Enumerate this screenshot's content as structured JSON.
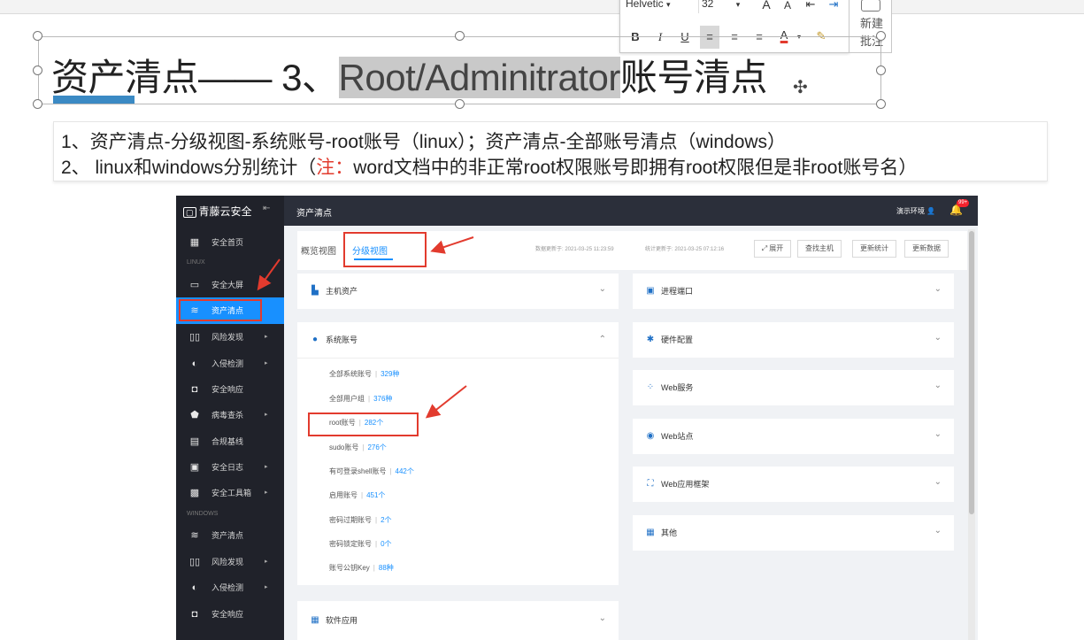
{
  "toolbar": {
    "font_name": "Helvetic",
    "font_size": "32",
    "font_dropdown": "▾",
    "size_dropdown": "▾",
    "grow_font": "A",
    "shrink_font": "A",
    "bold": "B",
    "italic": "I",
    "underline": "U",
    "font_color": "A",
    "new_comment": "新建批注"
  },
  "slide": {
    "title_prefix": "资产清点—— 3、",
    "title_selected": "Root/Adminitrator",
    "title_suffix": "账号清点",
    "desc_line1": "1、资产清点-分级视图-系统账号-root账号（linux）；资产清点-全部账号清点（windows）",
    "desc_line2_a": "2、 linux和windows分别统计（",
    "desc_line2_note": "注：",
    "desc_line2_b": "word文档中的非正常root权限账号即拥有root权限但是非root账号名）"
  },
  "app": {
    "logo": "青藤云安全",
    "fold_icon": "⇤",
    "topbar_title": "资产清点",
    "env_label": "演示环境",
    "badge": "99+",
    "sidebar": {
      "group_linux": "LINUX",
      "group_windows": "WINDOWS",
      "items": [
        {
          "icon": "▦",
          "label": "安全首页",
          "arrow": ""
        },
        {
          "icon": "▭",
          "label": "安全大屏",
          "arrow": ""
        },
        {
          "icon": "≋",
          "label": "资产清点",
          "arrow": ""
        },
        {
          "icon": "▯▯",
          "label": "风险发现",
          "arrow": "▸"
        },
        {
          "icon": "◐",
          "label": "入侵检测",
          "arrow": "▸"
        },
        {
          "icon": "◘",
          "label": "安全响应",
          "arrow": ""
        },
        {
          "icon": "⬟",
          "label": "病毒查杀",
          "arrow": "▸"
        },
        {
          "icon": "▤",
          "label": "合规基线",
          "arrow": ""
        },
        {
          "icon": "▣",
          "label": "安全日志",
          "arrow": "▸"
        },
        {
          "icon": "▩",
          "label": "安全工具箱",
          "arrow": "▸"
        },
        {
          "icon": "≋",
          "label": "资产清点",
          "arrow": ""
        },
        {
          "icon": "▯▯",
          "label": "风险发现",
          "arrow": "▸"
        },
        {
          "icon": "◐",
          "label": "入侵检测",
          "arrow": "▸"
        },
        {
          "icon": "◘",
          "label": "安全响应",
          "arrow": ""
        }
      ]
    },
    "tabs": [
      "概览视图",
      "分级视图"
    ],
    "data_update_time": "数据更新于: 2021-03-25 11:23:59",
    "stats_update_time": "统计更新于: 2021-03-25 07:12:16",
    "buttons": {
      "expand": "⤢ 展开",
      "find_host": "查找主机",
      "update_stats": "更新统计",
      "update_data": "更新数据"
    },
    "cards_left": {
      "host_assets": "主机资产",
      "system_accounts": "系统账号",
      "software_apps": "软件应用"
    },
    "cards_right": [
      "进程端口",
      "硬件配置",
      "Web服务",
      "Web站点",
      "Web应用框架",
      "其他"
    ],
    "card_icons_right": [
      "▣",
      "✱",
      "⁘",
      "◉",
      "⛶",
      "▦"
    ],
    "account_rows": [
      {
        "label": "全部系统账号",
        "count": "329种"
      },
      {
        "label": "全部用户组",
        "count": "376种"
      },
      {
        "label": "root账号",
        "count": "282个"
      },
      {
        "label": "sudo账号",
        "count": "276个"
      },
      {
        "label": "有可登录shell账号",
        "count": "442个"
      },
      {
        "label": "启用账号",
        "count": "451个"
      },
      {
        "label": "密码过期账号",
        "count": "2个"
      },
      {
        "label": "密码锁定账号",
        "count": "0个"
      },
      {
        "label": "账号公钥Key",
        "count": "88种"
      }
    ],
    "chevron_down": "⌄",
    "chevron_up": "⌃",
    "separator": "|"
  },
  "colors": {
    "accent": "#1890ff",
    "sidebar_bg": "#20222a",
    "annotation_red": "#e23b2e",
    "title_bar": "#3b8ac4"
  }
}
